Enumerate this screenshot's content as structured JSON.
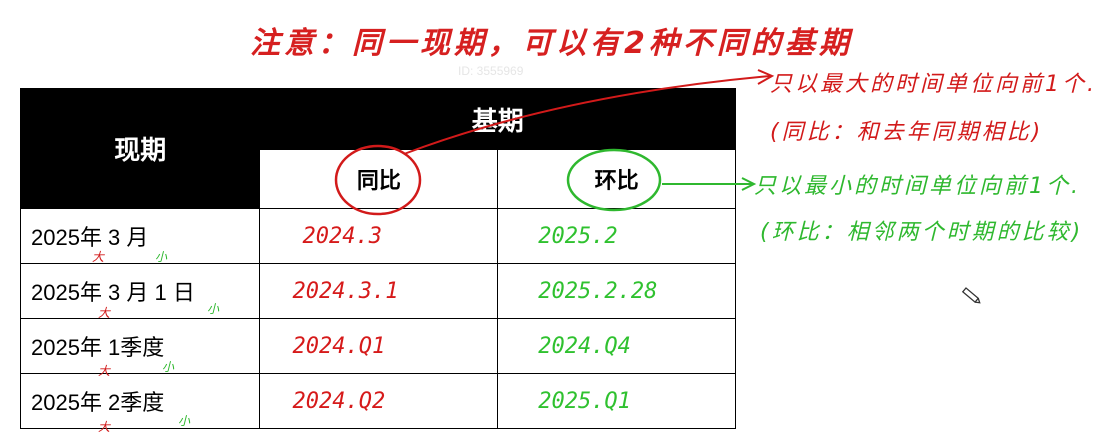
{
  "title": "注意：同一现期，可以有2种不同的基期",
  "watermark": "ID: 3555969",
  "table": {
    "header_current": "现期",
    "header_base": "基期",
    "sub_yoy": "同比",
    "sub_mom": "环比",
    "rows": [
      {
        "current": "2025年 3 月",
        "yoy": "2024.3",
        "mom": "2025.2"
      },
      {
        "current": "2025年 3 月 1 日",
        "yoy": "2024.3.1",
        "mom": "2025.2.28"
      },
      {
        "current": "2025年 1季度",
        "yoy": "2024.Q1",
        "mom": "2024.Q4"
      },
      {
        "current": "2025年 2季度",
        "yoy": "2024.Q2",
        "mom": "2025.Q1"
      }
    ]
  },
  "notes": {
    "yoy_line1": "只以最大的时间单位向前1个.",
    "yoy_line2": "(同比：和去年同期相比)",
    "mom_line1": "只以最小的时间单位向前1个.",
    "mom_line2": "(环比：相邻两个时期的比较)"
  },
  "marks": {
    "big": "大",
    "small": "小"
  },
  "colors": {
    "red": "#d21a1a",
    "green": "#2fb82f",
    "header_bg": "#000000"
  }
}
